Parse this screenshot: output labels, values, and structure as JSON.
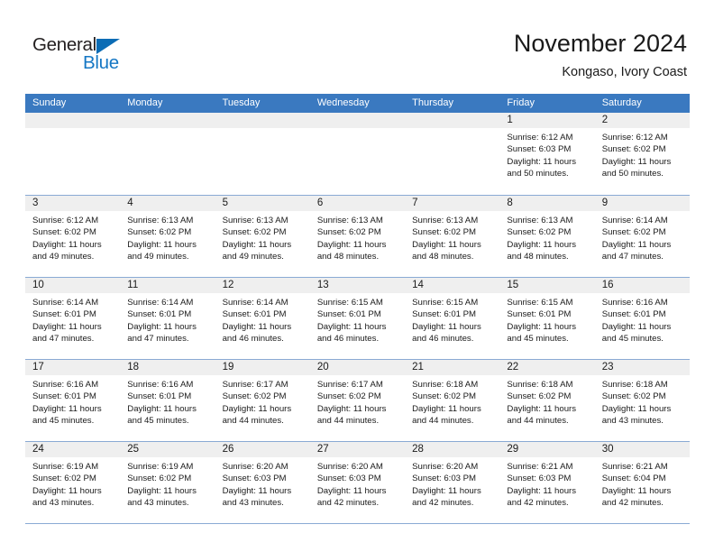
{
  "logo": {
    "word1": "General",
    "word2": "Blue",
    "triangle_color": "#0b6cb5",
    "word2_color": "#1577c4"
  },
  "header": {
    "title": "November 2024",
    "subtitle": "Kongaso, Ivory Coast"
  },
  "theme": {
    "header_blue": "#3a79c0",
    "day_band_gray": "#efefef",
    "row_border": "#8aaad4"
  },
  "weekdays": [
    "Sunday",
    "Monday",
    "Tuesday",
    "Wednesday",
    "Thursday",
    "Friday",
    "Saturday"
  ],
  "weeks": [
    [
      {
        "day": "",
        "sunrise": "",
        "sunset": "",
        "daylight1": "",
        "daylight2": ""
      },
      {
        "day": "",
        "sunrise": "",
        "sunset": "",
        "daylight1": "",
        "daylight2": ""
      },
      {
        "day": "",
        "sunrise": "",
        "sunset": "",
        "daylight1": "",
        "daylight2": ""
      },
      {
        "day": "",
        "sunrise": "",
        "sunset": "",
        "daylight1": "",
        "daylight2": ""
      },
      {
        "day": "",
        "sunrise": "",
        "sunset": "",
        "daylight1": "",
        "daylight2": ""
      },
      {
        "day": "1",
        "sunrise": "Sunrise: 6:12 AM",
        "sunset": "Sunset: 6:03 PM",
        "daylight1": "Daylight: 11 hours",
        "daylight2": "and 50 minutes."
      },
      {
        "day": "2",
        "sunrise": "Sunrise: 6:12 AM",
        "sunset": "Sunset: 6:02 PM",
        "daylight1": "Daylight: 11 hours",
        "daylight2": "and 50 minutes."
      }
    ],
    [
      {
        "day": "3",
        "sunrise": "Sunrise: 6:12 AM",
        "sunset": "Sunset: 6:02 PM",
        "daylight1": "Daylight: 11 hours",
        "daylight2": "and 49 minutes."
      },
      {
        "day": "4",
        "sunrise": "Sunrise: 6:13 AM",
        "sunset": "Sunset: 6:02 PM",
        "daylight1": "Daylight: 11 hours",
        "daylight2": "and 49 minutes."
      },
      {
        "day": "5",
        "sunrise": "Sunrise: 6:13 AM",
        "sunset": "Sunset: 6:02 PM",
        "daylight1": "Daylight: 11 hours",
        "daylight2": "and 49 minutes."
      },
      {
        "day": "6",
        "sunrise": "Sunrise: 6:13 AM",
        "sunset": "Sunset: 6:02 PM",
        "daylight1": "Daylight: 11 hours",
        "daylight2": "and 48 minutes."
      },
      {
        "day": "7",
        "sunrise": "Sunrise: 6:13 AM",
        "sunset": "Sunset: 6:02 PM",
        "daylight1": "Daylight: 11 hours",
        "daylight2": "and 48 minutes."
      },
      {
        "day": "8",
        "sunrise": "Sunrise: 6:13 AM",
        "sunset": "Sunset: 6:02 PM",
        "daylight1": "Daylight: 11 hours",
        "daylight2": "and 48 minutes."
      },
      {
        "day": "9",
        "sunrise": "Sunrise: 6:14 AM",
        "sunset": "Sunset: 6:02 PM",
        "daylight1": "Daylight: 11 hours",
        "daylight2": "and 47 minutes."
      }
    ],
    [
      {
        "day": "10",
        "sunrise": "Sunrise: 6:14 AM",
        "sunset": "Sunset: 6:01 PM",
        "daylight1": "Daylight: 11 hours",
        "daylight2": "and 47 minutes."
      },
      {
        "day": "11",
        "sunrise": "Sunrise: 6:14 AM",
        "sunset": "Sunset: 6:01 PM",
        "daylight1": "Daylight: 11 hours",
        "daylight2": "and 47 minutes."
      },
      {
        "day": "12",
        "sunrise": "Sunrise: 6:14 AM",
        "sunset": "Sunset: 6:01 PM",
        "daylight1": "Daylight: 11 hours",
        "daylight2": "and 46 minutes."
      },
      {
        "day": "13",
        "sunrise": "Sunrise: 6:15 AM",
        "sunset": "Sunset: 6:01 PM",
        "daylight1": "Daylight: 11 hours",
        "daylight2": "and 46 minutes."
      },
      {
        "day": "14",
        "sunrise": "Sunrise: 6:15 AM",
        "sunset": "Sunset: 6:01 PM",
        "daylight1": "Daylight: 11 hours",
        "daylight2": "and 46 minutes."
      },
      {
        "day": "15",
        "sunrise": "Sunrise: 6:15 AM",
        "sunset": "Sunset: 6:01 PM",
        "daylight1": "Daylight: 11 hours",
        "daylight2": "and 45 minutes."
      },
      {
        "day": "16",
        "sunrise": "Sunrise: 6:16 AM",
        "sunset": "Sunset: 6:01 PM",
        "daylight1": "Daylight: 11 hours",
        "daylight2": "and 45 minutes."
      }
    ],
    [
      {
        "day": "17",
        "sunrise": "Sunrise: 6:16 AM",
        "sunset": "Sunset: 6:01 PM",
        "daylight1": "Daylight: 11 hours",
        "daylight2": "and 45 minutes."
      },
      {
        "day": "18",
        "sunrise": "Sunrise: 6:16 AM",
        "sunset": "Sunset: 6:01 PM",
        "daylight1": "Daylight: 11 hours",
        "daylight2": "and 45 minutes."
      },
      {
        "day": "19",
        "sunrise": "Sunrise: 6:17 AM",
        "sunset": "Sunset: 6:02 PM",
        "daylight1": "Daylight: 11 hours",
        "daylight2": "and 44 minutes."
      },
      {
        "day": "20",
        "sunrise": "Sunrise: 6:17 AM",
        "sunset": "Sunset: 6:02 PM",
        "daylight1": "Daylight: 11 hours",
        "daylight2": "and 44 minutes."
      },
      {
        "day": "21",
        "sunrise": "Sunrise: 6:18 AM",
        "sunset": "Sunset: 6:02 PM",
        "daylight1": "Daylight: 11 hours",
        "daylight2": "and 44 minutes."
      },
      {
        "day": "22",
        "sunrise": "Sunrise: 6:18 AM",
        "sunset": "Sunset: 6:02 PM",
        "daylight1": "Daylight: 11 hours",
        "daylight2": "and 44 minutes."
      },
      {
        "day": "23",
        "sunrise": "Sunrise: 6:18 AM",
        "sunset": "Sunset: 6:02 PM",
        "daylight1": "Daylight: 11 hours",
        "daylight2": "and 43 minutes."
      }
    ],
    [
      {
        "day": "24",
        "sunrise": "Sunrise: 6:19 AM",
        "sunset": "Sunset: 6:02 PM",
        "daylight1": "Daylight: 11 hours",
        "daylight2": "and 43 minutes."
      },
      {
        "day": "25",
        "sunrise": "Sunrise: 6:19 AM",
        "sunset": "Sunset: 6:02 PM",
        "daylight1": "Daylight: 11 hours",
        "daylight2": "and 43 minutes."
      },
      {
        "day": "26",
        "sunrise": "Sunrise: 6:20 AM",
        "sunset": "Sunset: 6:03 PM",
        "daylight1": "Daylight: 11 hours",
        "daylight2": "and 43 minutes."
      },
      {
        "day": "27",
        "sunrise": "Sunrise: 6:20 AM",
        "sunset": "Sunset: 6:03 PM",
        "daylight1": "Daylight: 11 hours",
        "daylight2": "and 42 minutes."
      },
      {
        "day": "28",
        "sunrise": "Sunrise: 6:20 AM",
        "sunset": "Sunset: 6:03 PM",
        "daylight1": "Daylight: 11 hours",
        "daylight2": "and 42 minutes."
      },
      {
        "day": "29",
        "sunrise": "Sunrise: 6:21 AM",
        "sunset": "Sunset: 6:03 PM",
        "daylight1": "Daylight: 11 hours",
        "daylight2": "and 42 minutes."
      },
      {
        "day": "30",
        "sunrise": "Sunrise: 6:21 AM",
        "sunset": "Sunset: 6:04 PM",
        "daylight1": "Daylight: 11 hours",
        "daylight2": "and 42 minutes."
      }
    ]
  ]
}
